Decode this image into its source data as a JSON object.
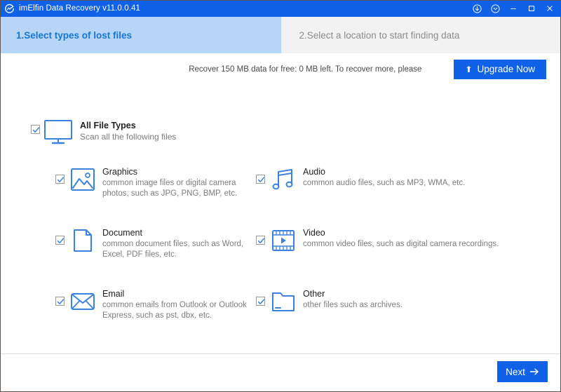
{
  "window": {
    "title": "imElfin Data Recovery v11.0.0.41",
    "logo_icon": "app-logo-icon",
    "titlebar_bg": "#1161e8",
    "buttons": [
      {
        "name": "download-button",
        "icon": "download-circle-icon"
      },
      {
        "name": "chevron-down-button",
        "icon": "chevron-down-circle-icon"
      },
      {
        "name": "minimize-button",
        "icon": "minimize-icon"
      },
      {
        "name": "maximize-button",
        "icon": "maximize-icon"
      },
      {
        "name": "close-button",
        "icon": "close-icon"
      }
    ]
  },
  "tabs": [
    {
      "label": "1.Select types of lost files",
      "active": true,
      "bg": "#b7d5f7",
      "color": "#1477d4"
    },
    {
      "label": "2.Select a location to start finding data",
      "active": false,
      "bg": "#f2f2f2",
      "color": "#8c8c8c"
    }
  ],
  "banner": {
    "message": "Recover 150 MB data for free: 0 MB left. To recover more, please",
    "upgrade_label": "Upgrade Now",
    "upgrade_icon": "up-arrow-icon",
    "accent": "#1161e8"
  },
  "all_files": {
    "title": "All File Types",
    "subtitle": "Scan all the following files",
    "icon": "monitor-icon",
    "checked": true
  },
  "categories": [
    {
      "title": "Graphics",
      "desc": "common image files or digital camera photos, such as JPG, PNG, BMP, etc.",
      "icon": "image-icon",
      "checked": true
    },
    {
      "title": "Audio",
      "desc": "common audio files, such as MP3, WMA, etc.",
      "icon": "music-note-icon",
      "checked": true
    },
    {
      "title": "Document",
      "desc": "common document files, such as Word, Excel, PDF files, etc.",
      "icon": "document-page-icon",
      "checked": true
    },
    {
      "title": "Video",
      "desc": "common video files, such as digital camera recordings.",
      "icon": "film-play-icon",
      "checked": true
    },
    {
      "title": "Email",
      "desc": "common emails from Outlook or Outlook Express, such as pst, dbx, etc.",
      "icon": "envelope-icon",
      "checked": true
    },
    {
      "title": "Other",
      "desc": "other files such as archives.",
      "icon": "folder-icon",
      "checked": true
    }
  ],
  "footer": {
    "next_label": "Next",
    "next_icon": "arrow-right-icon"
  }
}
